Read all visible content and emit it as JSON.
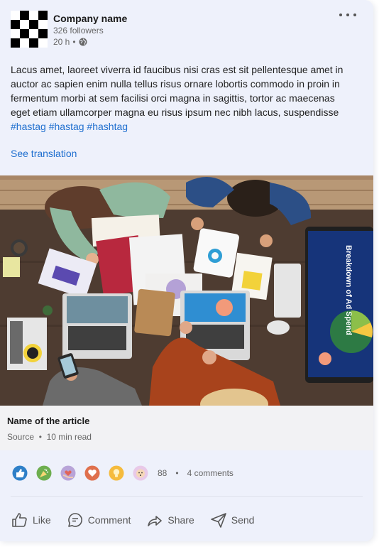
{
  "header": {
    "company_name": "Company name",
    "followers": "326 followers",
    "time": "20 h",
    "separator": "•"
  },
  "post": {
    "body": "Lacus amet, laoreet viverra id faucibus nisi cras est sit pellentesque amet in auctor ac sapien enim nulla tellus risus ornare lobortis commodo in proin in fermentum morbi at sem facilisi orci magna in sagittis, tortor ac maecenas eget etiam ullamcorper magna eu risus ipsum nec nibh lacus, suspendisse",
    "hashtags": "#hastag #hastag #hashtag",
    "translate": "See translation"
  },
  "image": {
    "screen_title": "Breakdown of Ad Spend"
  },
  "article": {
    "title": "Name of the article",
    "source": "Source",
    "read_time": "10 min read"
  },
  "reactions": {
    "count": "88",
    "comments": "4 comments",
    "icons": [
      "like-icon",
      "celebrate-icon",
      "support-icon",
      "love-icon",
      "insightful-icon",
      "curious-icon"
    ]
  },
  "actions": {
    "like": "Like",
    "comment": "Comment",
    "share": "Share",
    "send": "Send"
  },
  "colors": {
    "card_background": "#eef1fb",
    "link": "#1f6fcf"
  }
}
